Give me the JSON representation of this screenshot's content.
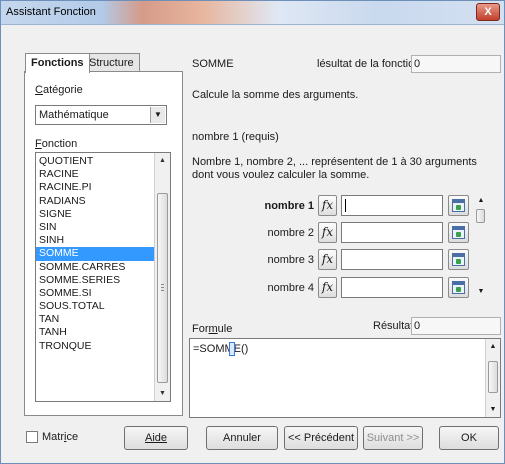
{
  "window": {
    "title": "Assistant Fonction",
    "close_symbol": "X"
  },
  "tabs": [
    {
      "label": "Fonctions",
      "active": true
    },
    {
      "label": "Structure",
      "active": false
    }
  ],
  "category": {
    "label": "Catégorie",
    "selected": "Mathématique"
  },
  "function_list": {
    "label": "Fonction",
    "items": [
      "QUOTIENT",
      "RACINE",
      "RACINE.PI",
      "RADIANS",
      "SIGNE",
      "SIN",
      "SINH",
      "SOMME",
      "SOMME.CARRES",
      "SOMME.SERIES",
      "SOMME.SI",
      "SOUS.TOTAL",
      "TAN",
      "TANH",
      "TRONQUE"
    ],
    "selected": "SOMME"
  },
  "function_info": {
    "name": "SOMME",
    "result_label": "Résultat de la fonction",
    "result_label_visible": "lésultat de la fonction",
    "result_value": "0",
    "description": "Calcule la somme des arguments.",
    "arg_title": "nombre 1 (requis)",
    "arg_description": "Nombre 1, nombre 2, ... représentent de 1 à 30 arguments dont vous voulez calculer la somme."
  },
  "arguments": [
    {
      "label": "nombre 1",
      "value": "",
      "bold": true
    },
    {
      "label": "nombre 2",
      "value": "",
      "bold": false
    },
    {
      "label": "nombre 3",
      "value": "",
      "bold": false
    },
    {
      "label": "nombre 4",
      "value": "",
      "bold": false
    }
  ],
  "formula": {
    "label": "Formule",
    "result_label": "Résultat",
    "result_value": "0",
    "text": "=SOMME()"
  },
  "matrix": {
    "label": "Matrice",
    "checked": false
  },
  "buttons": {
    "help": "Aide",
    "cancel": "Annuler",
    "previous": "<< Précédent",
    "next": "Suivant >>",
    "ok": "OK"
  },
  "icons": {
    "fx": "fx",
    "combo_arrow": "▼",
    "scroll_up": "▲",
    "scroll_down": "▼"
  },
  "colors": {
    "selection": "#3399ff",
    "title_accent": "#d59b8a",
    "close_button": "#c0402a"
  }
}
